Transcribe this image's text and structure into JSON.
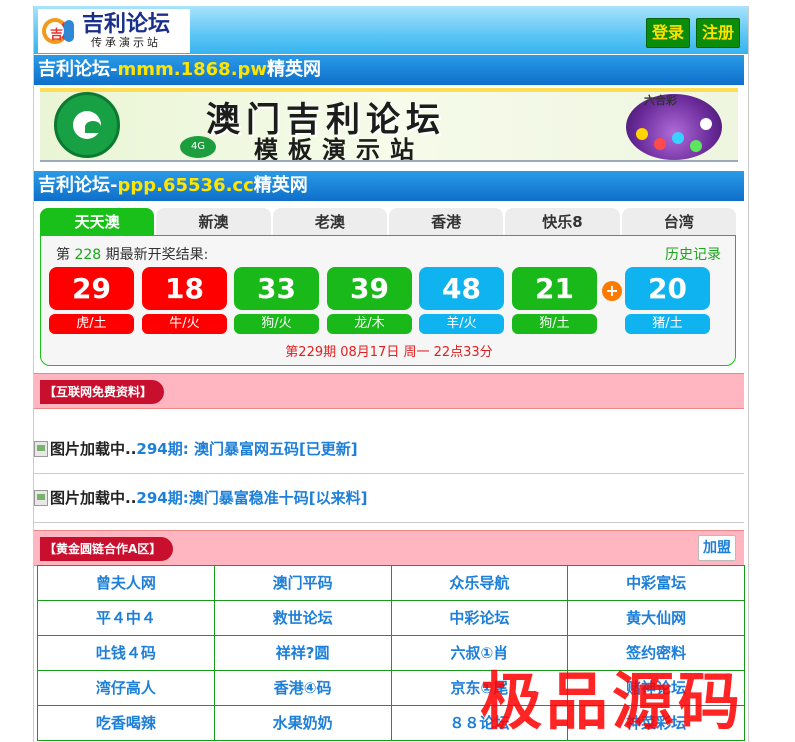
{
  "header": {
    "logo_title": "吉利论坛",
    "logo_subtitle": "传承演示站",
    "logo_mark_char": "吉",
    "login_label": "登录",
    "register_label": "注册"
  },
  "site_bars": [
    {
      "prefix": "吉利论坛-",
      "domain": "mmm.1868.pw",
      "suffix": "精英网"
    },
    {
      "prefix": "吉利论坛-",
      "domain": "ppp.65536.cc",
      "suffix": "精英网"
    }
  ],
  "banner": {
    "title": "澳门吉利论坛",
    "subtitle": "模板演示站",
    "badge": "4G",
    "lottery_label": "六合彩"
  },
  "tabs": [
    {
      "label": "天天澳",
      "active": true
    },
    {
      "label": "新澳",
      "active": false
    },
    {
      "label": "老澳",
      "active": false
    },
    {
      "label": "香港",
      "active": false
    },
    {
      "label": "快乐8",
      "active": false
    },
    {
      "label": "台湾",
      "active": false
    }
  ],
  "draw": {
    "prefix": "第 ",
    "period": "228",
    "suffix": " 期最新开奖结果:",
    "history_label": "历史记录",
    "balls": [
      {
        "number": "29",
        "zodiac": "虎/土",
        "color": "red"
      },
      {
        "number": "18",
        "zodiac": "牛/火",
        "color": "red"
      },
      {
        "number": "33",
        "zodiac": "狗/火",
        "color": "green"
      },
      {
        "number": "39",
        "zodiac": "龙/木",
        "color": "green"
      },
      {
        "number": "48",
        "zodiac": "羊/火",
        "color": "blue"
      },
      {
        "number": "21",
        "zodiac": "狗/土",
        "color": "green"
      },
      {
        "number": "20",
        "zodiac": "猪/土",
        "color": "blue"
      }
    ],
    "plus": "+",
    "next_draw": "第229期 08月17日 周一 22点33分"
  },
  "section_free": {
    "title": "【互联网免费资料】",
    "items": [
      {
        "img_alt": "图片加载中..",
        "text": "294期: 澳门暴富网五码[已更新]"
      },
      {
        "img_alt": "图片加载中..",
        "text": "294期:澳门暴富稳准十码[以来料]"
      }
    ]
  },
  "section_links": {
    "title": "【黄金圆链合作A区】",
    "join_label": "加盟",
    "rows": [
      [
        "曾夫人网",
        "澳门平码",
        "众乐导航",
        "中彩富坛"
      ],
      [
        "平４中４",
        "救世论坛",
        "中彩论坛",
        "黄大仙网"
      ],
      [
        "吐钱４码",
        "祥祥?圆",
        "六叔①肖",
        "签约密料"
      ],
      [
        "湾仔高人",
        "香港④码",
        "京东①尾",
        "赌神论坛"
      ],
      [
        "吃香喝辣",
        "水果奶奶",
        "８８论坛",
        "神菜彩坛"
      ]
    ]
  },
  "watermark": "极品源码",
  "colors": {
    "red": "#ff0000",
    "green": "#18b918",
    "blue": "#0eb3f0",
    "accent_link": "#1e7fd8",
    "domain_yellow": "#ffe400"
  }
}
